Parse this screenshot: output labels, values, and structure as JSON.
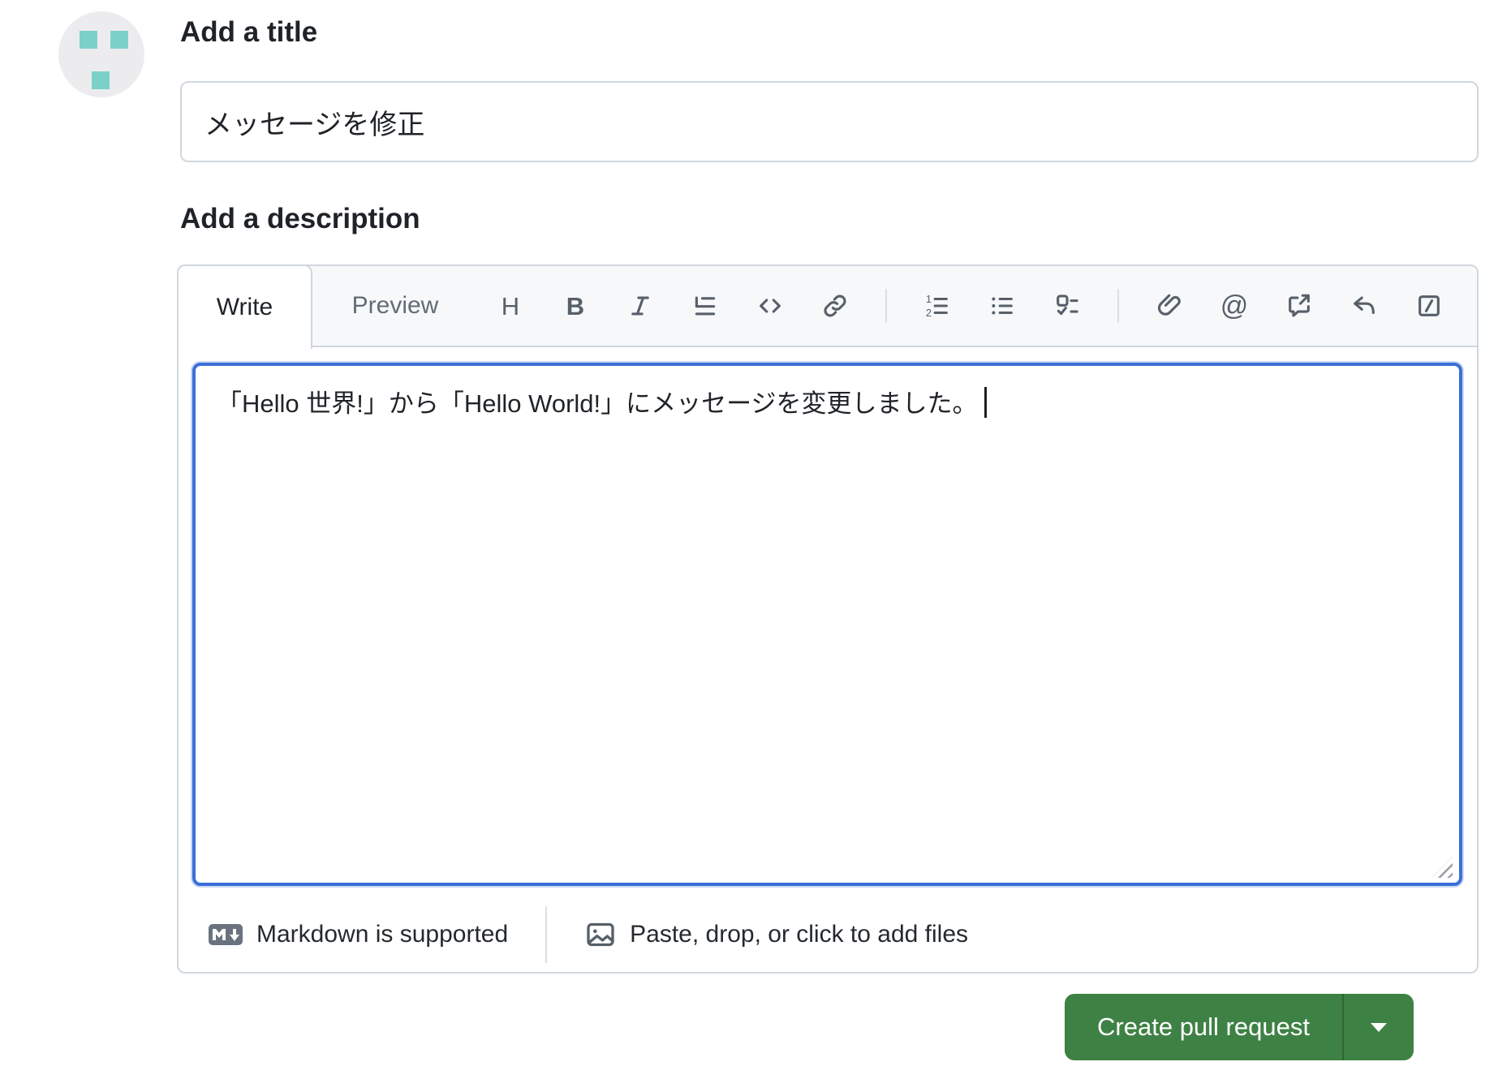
{
  "avatar": {
    "name": "user-identicon-avatar",
    "square_color": "#7bd1ca",
    "background": "#ececee"
  },
  "title_section": {
    "label": "Add a title",
    "value": "メッセージを修正"
  },
  "description_section": {
    "label": "Add a description",
    "tabs": {
      "write": "Write",
      "preview": "Preview"
    },
    "toolbar_icons": [
      "heading",
      "bold",
      "italic",
      "quote",
      "code",
      "link",
      "ordered-list",
      "unordered-list",
      "task-list",
      "attach",
      "mention",
      "cross-reference",
      "reply",
      "slash-commands"
    ],
    "editor_text": "「Hello 世界!」から「Hello World!」にメッセージを変更しました。",
    "footer": {
      "markdown_hint": "Markdown is supported",
      "attach_hint": "Paste, drop, or click to add files"
    }
  },
  "actions": {
    "create_pull_request": "Create pull request"
  },
  "colors": {
    "primary_green": "#3e8144",
    "focus_border_blue": "#3c6fd7",
    "border_gray": "#d0d7de",
    "toolbar_bg": "#f6f8fa",
    "icon_gray": "#57606a",
    "identicon_teal": "#7bd1ca"
  }
}
